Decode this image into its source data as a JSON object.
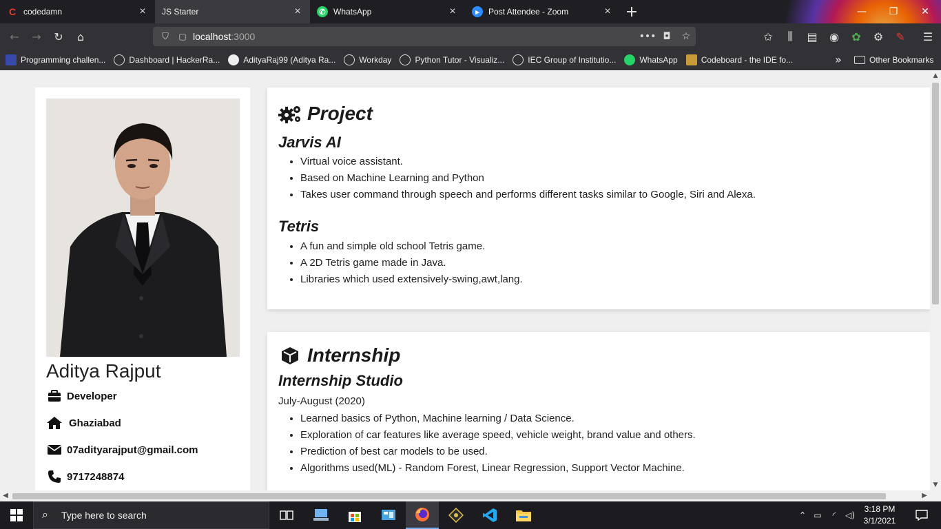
{
  "browser": {
    "tabs": [
      {
        "title": "codedamn",
        "icon": "codedamn-icon",
        "active": false
      },
      {
        "title": "JS Starter",
        "icon": "",
        "active": true
      },
      {
        "title": "WhatsApp",
        "icon": "whatsapp-icon",
        "active": false
      },
      {
        "title": "Post Attendee - Zoom",
        "icon": "zoom-icon",
        "active": false
      }
    ],
    "url_host": "localhost",
    "url_port": ":3000",
    "bookmarks": [
      "Programming challen...",
      "Dashboard | HackerRa...",
      "AdityaRaj99 (Aditya Ra...",
      "Workday",
      "Python Tutor - Visualiz...",
      "IEC Group of Institutio...",
      "WhatsApp",
      "Codeboard - the IDE fo..."
    ],
    "other_bookmarks": "Other Bookmarks"
  },
  "profile": {
    "name": "Aditya Rajput",
    "role": "Developer",
    "location": "Ghaziabad",
    "email": "07adityarajput@gmail.com",
    "phone": "9717248874"
  },
  "project": {
    "heading": "Project",
    "items": [
      {
        "title": "Jarvis AI",
        "points": [
          "Virtual voice assistant.",
          "Based on Machine Learning and Python",
          "Takes user command through speech and performs different tasks similar to Google, Siri and Alexa."
        ]
      },
      {
        "title": "Tetris",
        "points": [
          "A fun and simple old school Tetris game.",
          "A 2D Tetris game made in Java.",
          "Libraries which used extensively-swing,awt,lang."
        ]
      }
    ]
  },
  "internship": {
    "heading": "Internship",
    "company": "Internship Studio",
    "period": "July-August (2020)",
    "points": [
      "Learned basics of Python, Machine learning / Data Science.",
      "Exploration of car features like average speed, vehicle weight, brand value and others.",
      "Prediction of best car models to be used.",
      "Algorithms used(ML) - Random Forest, Linear Regression, Support Vector Machine."
    ]
  },
  "taskbar": {
    "search_placeholder": "Type here to search",
    "time": "3:18 PM",
    "date": "3/1/2021"
  }
}
